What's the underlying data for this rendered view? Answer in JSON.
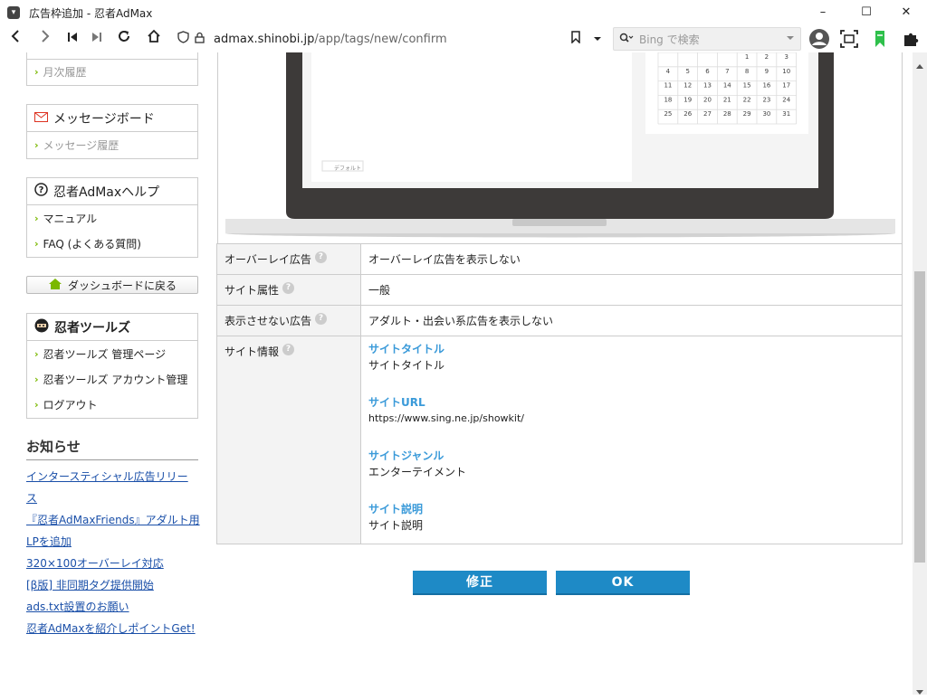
{
  "window": {
    "title": "広告枠追加 - 忍者AdMax",
    "minimize": "–",
    "maximize": "☐",
    "close": "✕"
  },
  "nav": {
    "url_host": "admax.shinobi.jp",
    "url_path": "/app/tags/new/confirm",
    "search_placeholder": "Bing で検索"
  },
  "sidebar": {
    "monthly_history": "月次履歴",
    "message_board": {
      "title": "メッセージボード",
      "items": [
        "メッセージ履歴"
      ]
    },
    "help": {
      "title": "忍者AdMaxヘルプ",
      "items": [
        "マニュアル",
        "FAQ (よくある質問)"
      ]
    },
    "dashboard_button": "ダッシュボードに戻る",
    "tools": {
      "title": "忍者ツールズ",
      "items": [
        "忍者ツールズ 管理ページ",
        "忍者ツールズ アカウント管理",
        "ログアウト"
      ]
    },
    "news": {
      "title": "お知らせ",
      "links": [
        "インタースティシャル広告リリー",
        "ス",
        "『忍者AdMaxFriends』アダルト用",
        "LPを追加",
        "320×100オーバーレイ対応",
        "[β版] 非同期タグ提供開始",
        "ads.txt設置のお願い",
        "忍者AdMaxを紹介しポイントGet!"
      ]
    }
  },
  "preview": {
    "calendar": [
      "1",
      "2",
      "3",
      "4",
      "5",
      "6",
      "7",
      "8",
      "9",
      "10",
      "11",
      "12",
      "13",
      "14",
      "15",
      "16",
      "17",
      "18",
      "19",
      "20",
      "21",
      "22",
      "23",
      "24",
      "25",
      "26",
      "27",
      "28",
      "29",
      "30",
      "31"
    ],
    "default_tag": "デフォルト"
  },
  "table": {
    "rows": [
      {
        "label": "オーバーレイ広告",
        "value": "オーバーレイ広告を表示しない"
      },
      {
        "label": "サイト属性",
        "value": "一般"
      },
      {
        "label": "表示させない広告",
        "value": "アダルト・出会い系広告を表示しない"
      }
    ],
    "site_info": {
      "label": "サイト情報",
      "title_key": "サイトタイトル",
      "title_value": "サイトタイトル",
      "url_key": "サイトURL",
      "url_value": "https://www.sing.ne.jp/showkit/",
      "genre_key": "サイトジャンル",
      "genre_value": "エンターテイメント",
      "desc_key": "サイト説明",
      "desc_value": "サイト説明"
    }
  },
  "buttons": {
    "edit": "修正",
    "ok": "OK"
  },
  "colors": {
    "accent": "#1e8ac6",
    "link": "#1a4fa8",
    "info_key": "#3a9ad9",
    "chevron": "#7ab800"
  }
}
